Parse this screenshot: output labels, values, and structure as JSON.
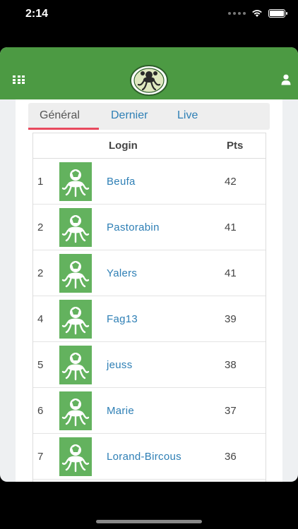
{
  "status_bar": {
    "time": "2:14"
  },
  "tabs": [
    {
      "label": "Général",
      "active": true
    },
    {
      "label": "Dernier",
      "active": false
    },
    {
      "label": "Live",
      "active": false
    }
  ],
  "table": {
    "headers": {
      "login": "Login",
      "pts": "Pts"
    },
    "rows": [
      {
        "rank": "1",
        "login": "Beufa",
        "pts": "42"
      },
      {
        "rank": "2",
        "login": "Pastorabin",
        "pts": "41"
      },
      {
        "rank": "2",
        "login": "Yalers",
        "pts": "41"
      },
      {
        "rank": "4",
        "login": "Fag13",
        "pts": "39"
      },
      {
        "rank": "5",
        "login": "jeuss",
        "pts": "38"
      },
      {
        "rank": "6",
        "login": "Marie",
        "pts": "37"
      },
      {
        "rank": "7",
        "login": "Lorand-Bircous",
        "pts": "36"
      }
    ]
  },
  "colors": {
    "brand_green": "#4c9a43",
    "avatar_green": "#63b25e",
    "link_blue": "#2e7fb5",
    "tab_accent": "#e8495e"
  },
  "icons": {
    "menu": "grid-icon",
    "account": "user-icon",
    "logo": "octopus-logo"
  }
}
